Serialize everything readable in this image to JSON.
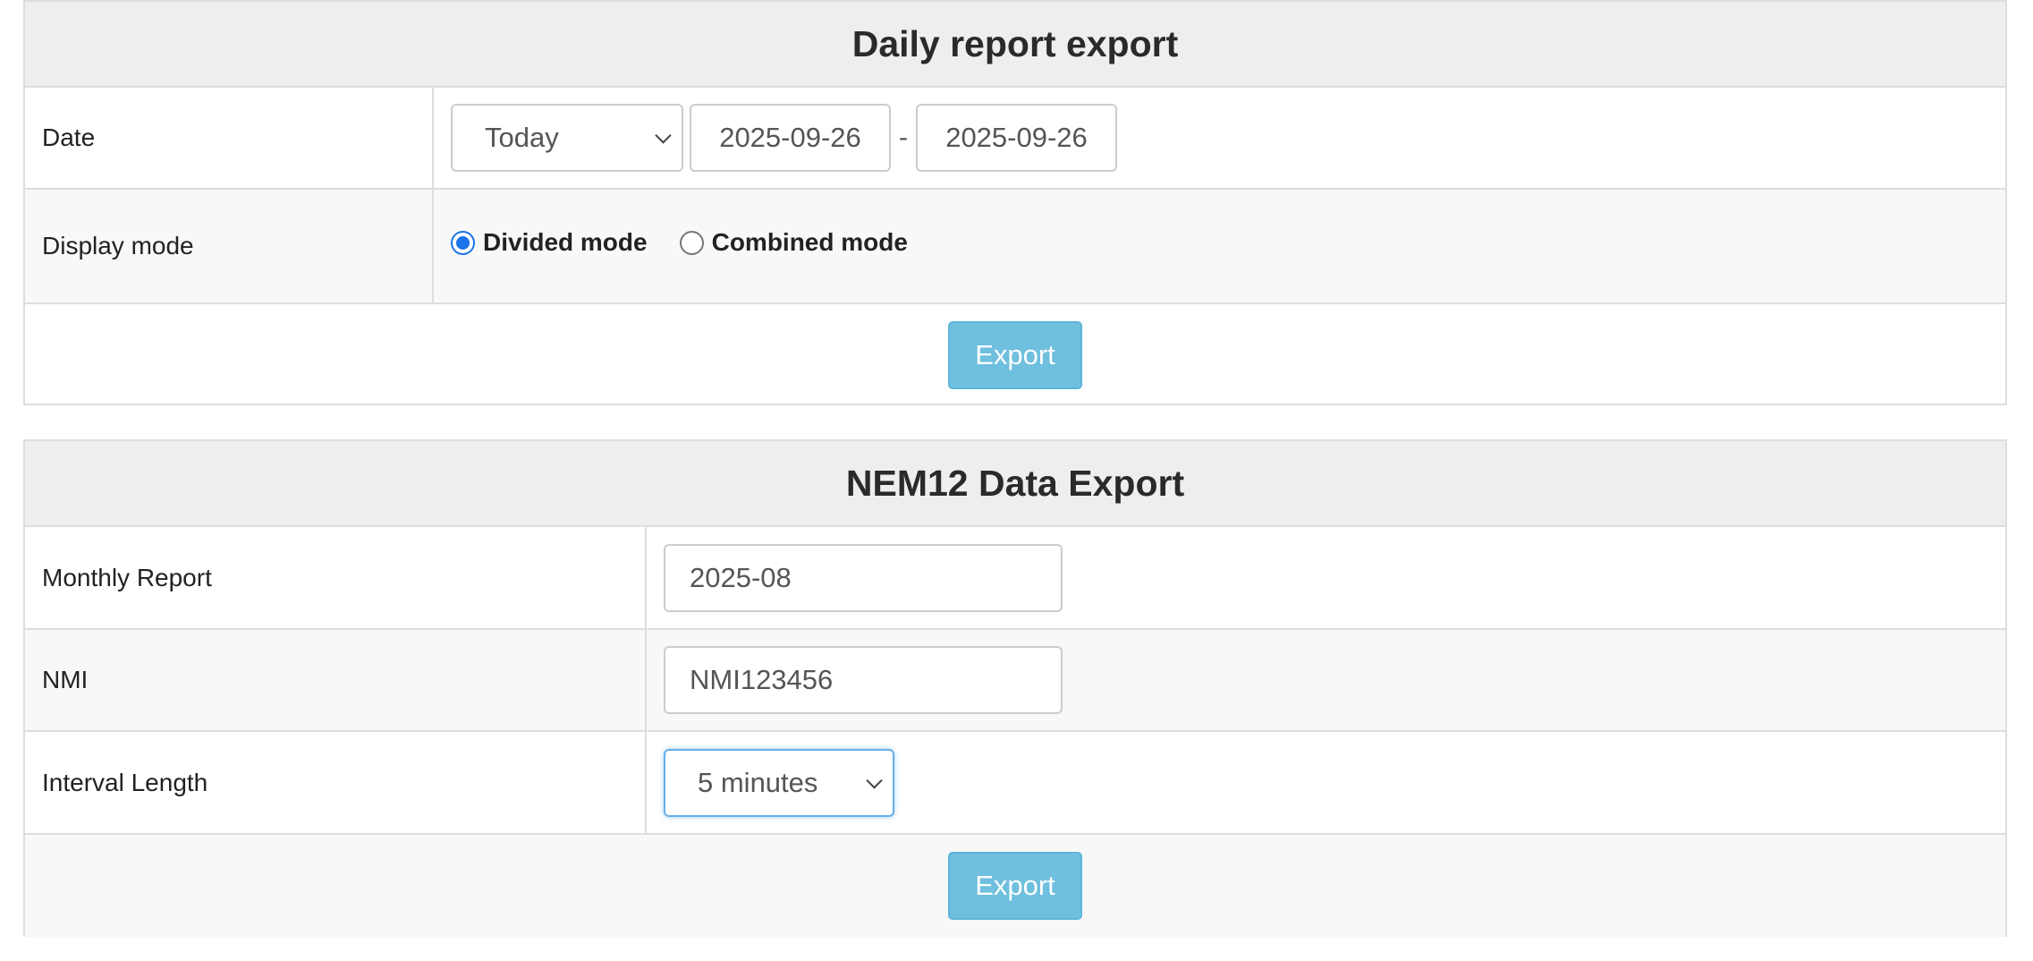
{
  "daily": {
    "title": "Daily report export",
    "date_label": "Date",
    "date_preset": "Today",
    "date_from": "2025-09-26",
    "date_sep": "-",
    "date_to": "2025-09-26",
    "display_mode_label": "Display mode",
    "mode_divided": "Divided mode",
    "mode_combined": "Combined mode",
    "selected_mode": "Divided mode",
    "export_label": "Export"
  },
  "nem12": {
    "title": "NEM12 Data Export",
    "monthly_label": "Monthly Report",
    "monthly_value": "2025-08",
    "nmi_label": "NMI",
    "nmi_value": "NMI123456",
    "interval_label": "Interval Length",
    "interval_value": "5 minutes",
    "export_label": "Export"
  },
  "colors": {
    "button": "#6fbfde",
    "header_bg": "#eeeeee",
    "radio_accent": "#1a73e8"
  }
}
